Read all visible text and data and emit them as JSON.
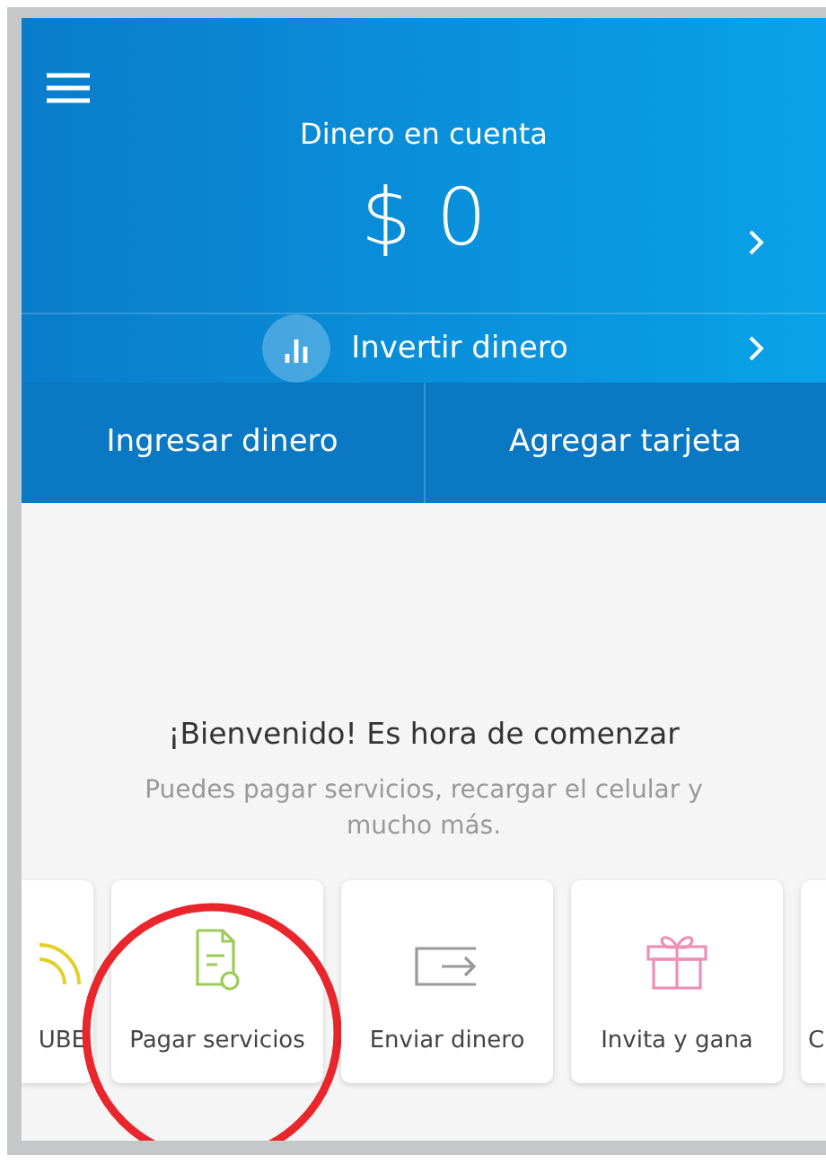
{
  "balance": {
    "label": "Dinero en cuenta",
    "amount": "$ 0"
  },
  "invest": {
    "label": "Invertir dinero"
  },
  "actions": [
    "Ingresar dinero",
    "Agregar tarjeta"
  ],
  "welcome": {
    "title": "¡Bienvenido! Es hora de comenzar",
    "subtitle": "Puedes pagar servicios, recargar el celular y mucho más."
  },
  "shortcuts": [
    {
      "kind": "recharge",
      "label": "UBE",
      "highlighted": false
    },
    {
      "kind": "bill",
      "label": "Pagar servicios",
      "highlighted": true
    },
    {
      "kind": "send",
      "label": "Enviar dinero",
      "highlighted": false
    },
    {
      "kind": "gift",
      "label": "Invita y gana",
      "highlighted": false
    },
    {
      "kind": "other",
      "label": "C",
      "highlighted": false
    }
  ]
}
